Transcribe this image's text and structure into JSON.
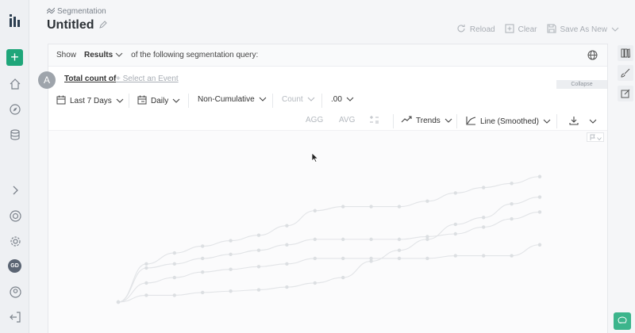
{
  "sidebar": {
    "logo": "app-logo-icon",
    "add": "+",
    "avatar_initials": "GD",
    "icons": [
      "home-icon",
      "compass-icon",
      "database-icon",
      "chevron-right-icon",
      "lifebuoy-icon",
      "gear-icon",
      "user-icon",
      "logout-icon"
    ]
  },
  "header": {
    "breadcrumb": "Segmentation",
    "title": "Untitled",
    "actions": {
      "reload": "Reload",
      "clear": "Clear",
      "save_as_new": "Save As New"
    }
  },
  "query": {
    "show_label": "Show",
    "results_value": "Results",
    "suffix": "of the following segmentation query:"
  },
  "event": {
    "avatar_letter": "A",
    "total_count": "Total count of",
    "select_event": "+ Select an Event",
    "collapse": "Collapse"
  },
  "controls": {
    "date_range": "Last 7 Days",
    "interval": "Daily",
    "cumulative": "Non-Cumulative",
    "count": "Count",
    "decimals": ".00",
    "agg": "AGG",
    "avg": "AVG",
    "trends": "Trends",
    "line_type": "Line (Smoothed)"
  },
  "chart_data": {
    "type": "line",
    "title": "",
    "series": [
      {
        "values": [
          0,
          28,
          36,
          41,
          45,
          49,
          56,
          67,
          70,
          70,
          70,
          74,
          80,
          84,
          87,
          92
        ]
      },
      {
        "values": [
          0,
          25,
          28,
          32,
          35,
          38,
          42,
          46,
          46,
          46,
          46,
          48,
          50,
          55,
          61,
          66
        ]
      },
      {
        "values": [
          0,
          5,
          5,
          7,
          8,
          9,
          11,
          14,
          18,
          30,
          38,
          46,
          57,
          62,
          72,
          77
        ]
      },
      {
        "values": [
          0,
          14,
          18,
          22,
          24,
          26,
          28,
          32,
          32,
          32,
          32,
          32,
          34,
          34,
          34,
          42
        ]
      }
    ],
    "ylim": [
      0,
      100
    ],
    "grid": false
  },
  "colors": {
    "accent": "#1fa67a",
    "chart_line": "#e2e4e7",
    "chart_dot": "#dcdfe2"
  }
}
